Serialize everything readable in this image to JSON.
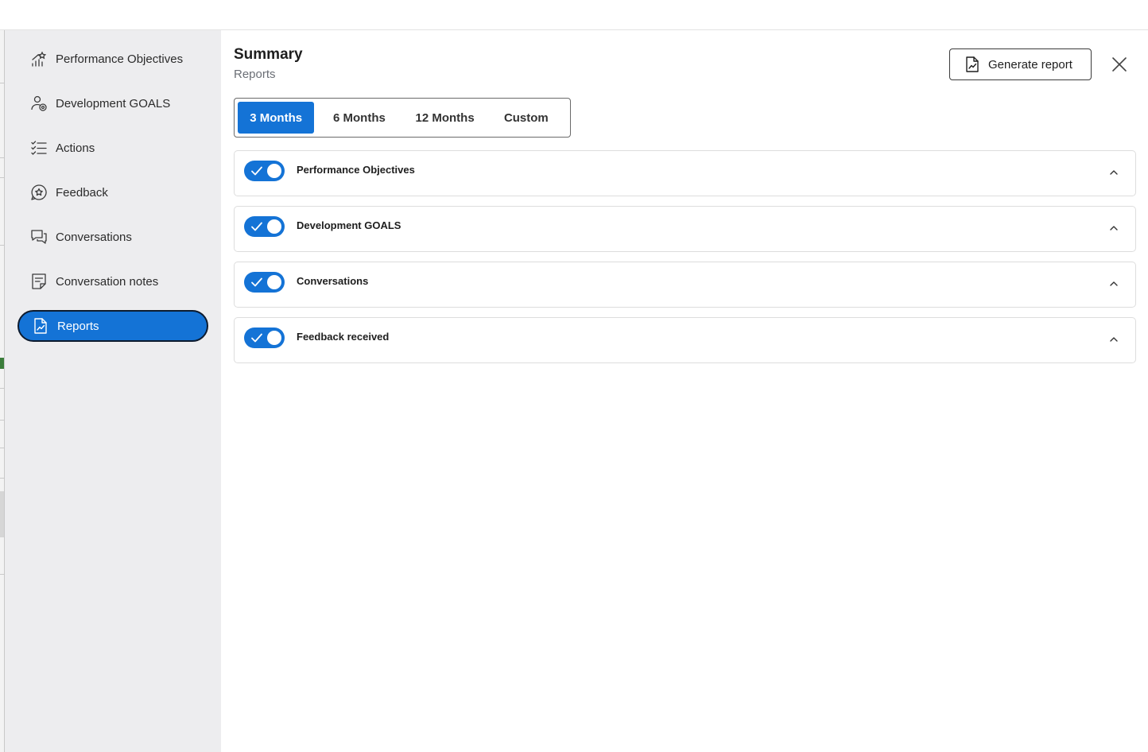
{
  "sidebar": {
    "items": [
      {
        "label": "Performance Objectives",
        "icon": "chart-growth-icon"
      },
      {
        "label": "Development GOALS",
        "icon": "user-target-icon"
      },
      {
        "label": "Actions",
        "icon": "checklist-icon"
      },
      {
        "label": "Feedback",
        "icon": "star-chat-icon"
      },
      {
        "label": "Conversations",
        "icon": "chat-bubbles-icon"
      },
      {
        "label": "Conversation notes",
        "icon": "notes-icon"
      },
      {
        "label": "Reports",
        "icon": "report-file-icon",
        "active": true
      }
    ]
  },
  "header": {
    "title": "Summary",
    "subtitle": "Reports",
    "generate_label": "Generate report"
  },
  "periods": {
    "options": [
      "3 Months",
      "6 Months",
      "12 Months",
      "Custom"
    ],
    "selected": "3 Months"
  },
  "sections": [
    {
      "label": "Performance Objectives",
      "enabled": true
    },
    {
      "label": "Development GOALS",
      "enabled": true
    },
    {
      "label": "Conversations",
      "enabled": true
    },
    {
      "label": "Feedback received",
      "enabled": true
    }
  ],
  "colors": {
    "accent": "#1473d6",
    "sidebar_bg": "#ededef",
    "active_outline": "#0d1b2e"
  }
}
